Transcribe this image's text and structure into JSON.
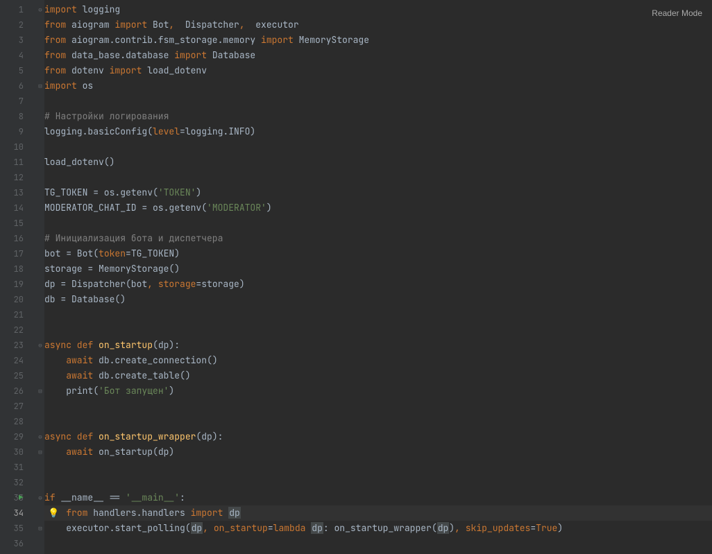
{
  "reader_mode": "Reader Mode",
  "current_line": 34,
  "run_marker_line": 33,
  "bulb_line": 34,
  "lines": [
    {
      "n": 1,
      "fold": "⊖",
      "tokens": [
        [
          "kw",
          "import"
        ],
        [
          "txt",
          " logging"
        ]
      ]
    },
    {
      "n": 2,
      "fold": "",
      "tokens": [
        [
          "kw",
          "from"
        ],
        [
          "txt",
          " aiogram "
        ],
        [
          "kw",
          "import"
        ],
        [
          "txt",
          " Bot"
        ],
        [
          "kw",
          ","
        ],
        [
          "txt",
          "  Dispatcher"
        ],
        [
          "kw",
          ","
        ],
        [
          "txt",
          "  executor"
        ]
      ]
    },
    {
      "n": 3,
      "fold": "",
      "tokens": [
        [
          "kw",
          "from"
        ],
        [
          "txt",
          " aiogram.contrib.fsm_storage.memory "
        ],
        [
          "kw",
          "import"
        ],
        [
          "txt",
          " MemoryStorage"
        ]
      ]
    },
    {
      "n": 4,
      "fold": "",
      "tokens": [
        [
          "kw",
          "from"
        ],
        [
          "txt",
          " data_base.database "
        ],
        [
          "kw",
          "import"
        ],
        [
          "txt",
          " Database"
        ]
      ]
    },
    {
      "n": 5,
      "fold": "",
      "tokens": [
        [
          "kw",
          "from"
        ],
        [
          "txt",
          " dotenv "
        ],
        [
          "kw",
          "import"
        ],
        [
          "txt",
          " load_dotenv"
        ]
      ]
    },
    {
      "n": 6,
      "fold": "⊟",
      "tokens": [
        [
          "kw",
          "import"
        ],
        [
          "txt",
          " os"
        ]
      ]
    },
    {
      "n": 7,
      "fold": "",
      "tokens": []
    },
    {
      "n": 8,
      "fold": "",
      "tokens": [
        [
          "com",
          "# Настройки логирования"
        ]
      ]
    },
    {
      "n": 9,
      "fold": "",
      "tokens": [
        [
          "txt",
          "logging.basicConfig("
        ],
        [
          "param",
          "level"
        ],
        [
          "txt",
          "=logging.INFO)"
        ]
      ]
    },
    {
      "n": 10,
      "fold": "",
      "tokens": []
    },
    {
      "n": 11,
      "fold": "",
      "tokens": [
        [
          "txt",
          "load_dotenv()"
        ]
      ]
    },
    {
      "n": 12,
      "fold": "",
      "tokens": []
    },
    {
      "n": 13,
      "fold": "",
      "tokens": [
        [
          "txt",
          "TG_TOKEN = os.getenv("
        ],
        [
          "str",
          "'TOKEN'"
        ],
        [
          "txt",
          ")"
        ]
      ]
    },
    {
      "n": 14,
      "fold": "",
      "tokens": [
        [
          "txt",
          "MODERATOR_CHAT_ID = os.getenv("
        ],
        [
          "str",
          "'MODERATOR'"
        ],
        [
          "txt",
          ")"
        ]
      ]
    },
    {
      "n": 15,
      "fold": "",
      "tokens": []
    },
    {
      "n": 16,
      "fold": "",
      "tokens": [
        [
          "com",
          "# Инициализация бота и диспетчера"
        ]
      ]
    },
    {
      "n": 17,
      "fold": "",
      "tokens": [
        [
          "txt",
          "bot = Bot("
        ],
        [
          "param",
          "token"
        ],
        [
          "txt",
          "=TG_TOKEN)"
        ]
      ]
    },
    {
      "n": 18,
      "fold": "",
      "tokens": [
        [
          "txt",
          "storage = MemoryStorage()"
        ]
      ]
    },
    {
      "n": 19,
      "fold": "",
      "tokens": [
        [
          "txt",
          "dp = Dispatcher(bot"
        ],
        [
          "kw",
          ", "
        ],
        [
          "param",
          "storage"
        ],
        [
          "txt",
          "=storage)"
        ]
      ]
    },
    {
      "n": 20,
      "fold": "",
      "tokens": [
        [
          "txt",
          "db = Database()"
        ]
      ]
    },
    {
      "n": 21,
      "fold": "",
      "tokens": []
    },
    {
      "n": 22,
      "fold": "",
      "tokens": []
    },
    {
      "n": 23,
      "fold": "⊖",
      "tokens": [
        [
          "kw",
          "async def "
        ],
        [
          "fn",
          "on_startup"
        ],
        [
          "txt",
          "(dp):"
        ]
      ]
    },
    {
      "n": 24,
      "fold": "",
      "tokens": [
        [
          "txt",
          "    "
        ],
        [
          "kw",
          "await"
        ],
        [
          "txt",
          " db.create_connection()"
        ]
      ]
    },
    {
      "n": 25,
      "fold": "",
      "tokens": [
        [
          "txt",
          "    "
        ],
        [
          "kw",
          "await"
        ],
        [
          "txt",
          " db.create_table()"
        ]
      ]
    },
    {
      "n": 26,
      "fold": "⊟",
      "tokens": [
        [
          "txt",
          "    print("
        ],
        [
          "str",
          "'Бот запущен'"
        ],
        [
          "txt",
          ")"
        ]
      ]
    },
    {
      "n": 27,
      "fold": "",
      "tokens": []
    },
    {
      "n": 28,
      "fold": "",
      "tokens": []
    },
    {
      "n": 29,
      "fold": "⊖",
      "tokens": [
        [
          "kw",
          "async def "
        ],
        [
          "fn",
          "on_startup_wrapper"
        ],
        [
          "txt",
          "(dp):"
        ]
      ]
    },
    {
      "n": 30,
      "fold": "⊟",
      "tokens": [
        [
          "txt",
          "    "
        ],
        [
          "kw",
          "await"
        ],
        [
          "txt",
          " on_startup(dp)"
        ]
      ]
    },
    {
      "n": 31,
      "fold": "",
      "tokens": []
    },
    {
      "n": 32,
      "fold": "",
      "tokens": []
    },
    {
      "n": 33,
      "fold": "⊖",
      "tokens": [
        [
          "kw",
          "if"
        ],
        [
          "txt",
          " __name__ == "
        ],
        [
          "str",
          "'__main__'"
        ],
        [
          "txt",
          ":"
        ]
      ]
    },
    {
      "n": 34,
      "fold": "",
      "tokens": [
        [
          "txt",
          "    "
        ],
        [
          "kw",
          "from"
        ],
        [
          "txt",
          " handlers.handlers "
        ],
        [
          "kw",
          "import "
        ],
        [
          "hl",
          "dp"
        ]
      ]
    },
    {
      "n": 35,
      "fold": "⊟",
      "tokens": [
        [
          "txt",
          "    executor.start_polling("
        ],
        [
          "hl",
          "dp"
        ],
        [
          "kw",
          ", "
        ],
        [
          "param",
          "on_startup"
        ],
        [
          "txt",
          "="
        ],
        [
          "kw",
          "lambda "
        ],
        [
          "hl",
          "dp"
        ],
        [
          "txt",
          ": on_startup_wrapper("
        ],
        [
          "hl",
          "dp"
        ],
        [
          "txt",
          ")"
        ],
        [
          "kw",
          ", "
        ],
        [
          "param",
          "skip_updates"
        ],
        [
          "txt",
          "="
        ],
        [
          "kw",
          "True"
        ],
        [
          "txt",
          ")"
        ]
      ]
    },
    {
      "n": 36,
      "fold": "",
      "tokens": []
    }
  ]
}
